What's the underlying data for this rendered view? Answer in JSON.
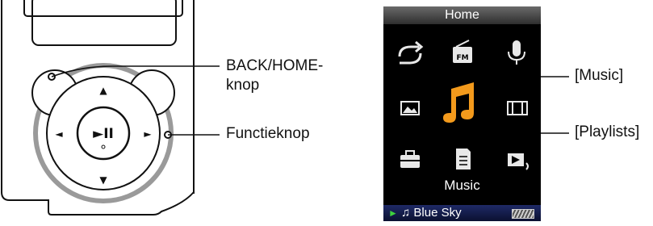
{
  "player": {
    "play_pause_glyph": "►II",
    "up_glyph": "▲",
    "down_glyph": "▼",
    "left_glyph": "◄",
    "right_glyph": "►"
  },
  "callouts": {
    "back_home_line1": "BACK/HOME-",
    "back_home_line2": "knop",
    "function": "Functieknop",
    "music": "[Music]",
    "playlists": "[Playlists]"
  },
  "screen": {
    "title": "Home",
    "selected_label": "Music",
    "status_track": "♫ Blue Sky",
    "status_play_glyph": "►",
    "fm_label": "FM",
    "icons": [
      "repeat-icon",
      "fm-radio-icon",
      "microphone-icon",
      "photo-icon",
      "music-note-icon",
      "video-icon",
      "settings-briefcase-icon",
      "playlist-icon",
      "now-playing-icon"
    ]
  },
  "colors": {
    "selected_icon_orange": "#f39a1c",
    "status_bar_blue": "#1f2a66",
    "play_indicator_green": "#3ed13e"
  }
}
